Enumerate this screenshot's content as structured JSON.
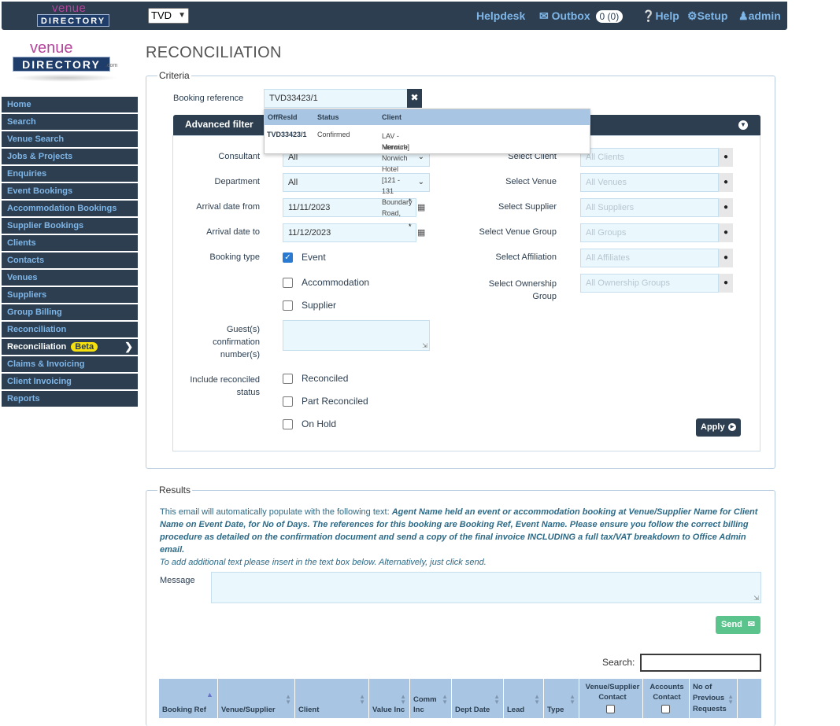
{
  "brand": {
    "logo_line1": "venue",
    "logo_line2": "DIRECTORY",
    "logo_com": ".com"
  },
  "topbar": {
    "site_select": "TVD",
    "helpdesk": "Helpdesk",
    "outbox": "Outbox",
    "outbox_count": "0 (0)",
    "help": "Help",
    "setup": "Setup",
    "user": "admin"
  },
  "sidebar": {
    "items": [
      {
        "label": "Home"
      },
      {
        "label": "Search"
      },
      {
        "label": "Venue Search"
      },
      {
        "label": "Jobs & Projects"
      },
      {
        "label": "Enquiries"
      },
      {
        "label": "Event Bookings"
      },
      {
        "label": "Accommodation Bookings"
      },
      {
        "label": "Supplier Bookings"
      },
      {
        "label": "Clients"
      },
      {
        "label": "Contacts"
      },
      {
        "label": "Venues"
      },
      {
        "label": "Suppliers"
      },
      {
        "label": "Group Billing"
      },
      {
        "label": "Reconciliation"
      },
      {
        "label": "Reconciliation",
        "badge": "Beta"
      },
      {
        "label": "Claims & Invoicing"
      },
      {
        "label": "Client Invoicing"
      },
      {
        "label": "Reports"
      }
    ]
  },
  "page": {
    "title": "RECONCILIATION"
  },
  "criteria": {
    "legend": "Criteria",
    "booking_ref_label": "Booking reference",
    "booking_ref_value": "TVD33423/1",
    "dropdown": {
      "headers": [
        "OffResId",
        "Status",
        "Client"
      ],
      "row": {
        "id": "TVD33423/1",
        "status": "Confirmed",
        "client_line1": "LAV - Mercure Norwich Hotel [121 - 131 Boundary Road,",
        "client_line2": "Norwich]"
      }
    },
    "advanced_title": "Advanced filter",
    "consultant_label": "Consultant",
    "consultant_value": "All",
    "department_label": "Department",
    "department_value": "All",
    "arrival_from_label": "Arrival date from",
    "arrival_from_value": "11/11/2023",
    "arrival_to_label": "Arrival date to",
    "arrival_to_value": "11/12/2023",
    "booking_type_label": "Booking type",
    "bt_event": "Event",
    "bt_accommodation": "Accommodation",
    "bt_supplier": "Supplier",
    "guest_label_1": "Guest(s)",
    "guest_label_2": "confirmation",
    "guest_label_3": "number(s)",
    "recon_label_1": "Include reconciled",
    "recon_label_2": "status",
    "rs_reconciled": "Reconciled",
    "rs_part": "Part Reconciled",
    "rs_onhold": "On Hold",
    "client_label": "Select Client",
    "client_ph": "All Clients",
    "venue_label": "Select Venue",
    "venue_ph": "All Venues",
    "supplier_label": "Select Supplier",
    "supplier_ph": "All Suppliers",
    "venue_group_label": "Select Venue Group",
    "venue_group_ph": "All Groups",
    "affiliation_label": "Select Affiliation",
    "affiliation_ph": "All Affiliates",
    "ownership_label_1": "Select Ownership",
    "ownership_label_2": "Group",
    "ownership_ph": "All Ownership Groups",
    "apply": "Apply"
  },
  "results": {
    "legend": "Results",
    "intro": "This email will automatically populate with the following text:",
    "template": "Agent Name held an event or accommodation booking at Venue/Supplier Name for Client Name on Event Date, for No of Days. The references for this booking are Booking Ref, Event Name. Please ensure you follow the correct billing procedure as detailed on the confirmation document and send a copy of the final invoice INCLUDING a full tax/VAT breakdown to Office Admin email.",
    "note": "To add additional text please insert in the text box below. Alternatively, just click send.",
    "message_label": "Message",
    "send": "Send",
    "search_label": "Search:",
    "columns": [
      "Booking Ref",
      "Venue/Supplier",
      "Client",
      "Value Inc",
      "Comm Inc",
      "Dept Date",
      "Lead",
      "Type",
      "Venue/Supplier Contact",
      "Accounts Contact",
      "No of Previous Requests"
    ]
  },
  "colors": {
    "navy": "#2c3e50",
    "link_blue": "#7fb6e8",
    "field_bg": "#eaf7fd",
    "header_blue": "#a8c6e3",
    "send_green": "#5bc48d",
    "beta_yellow": "#f7e10c"
  }
}
